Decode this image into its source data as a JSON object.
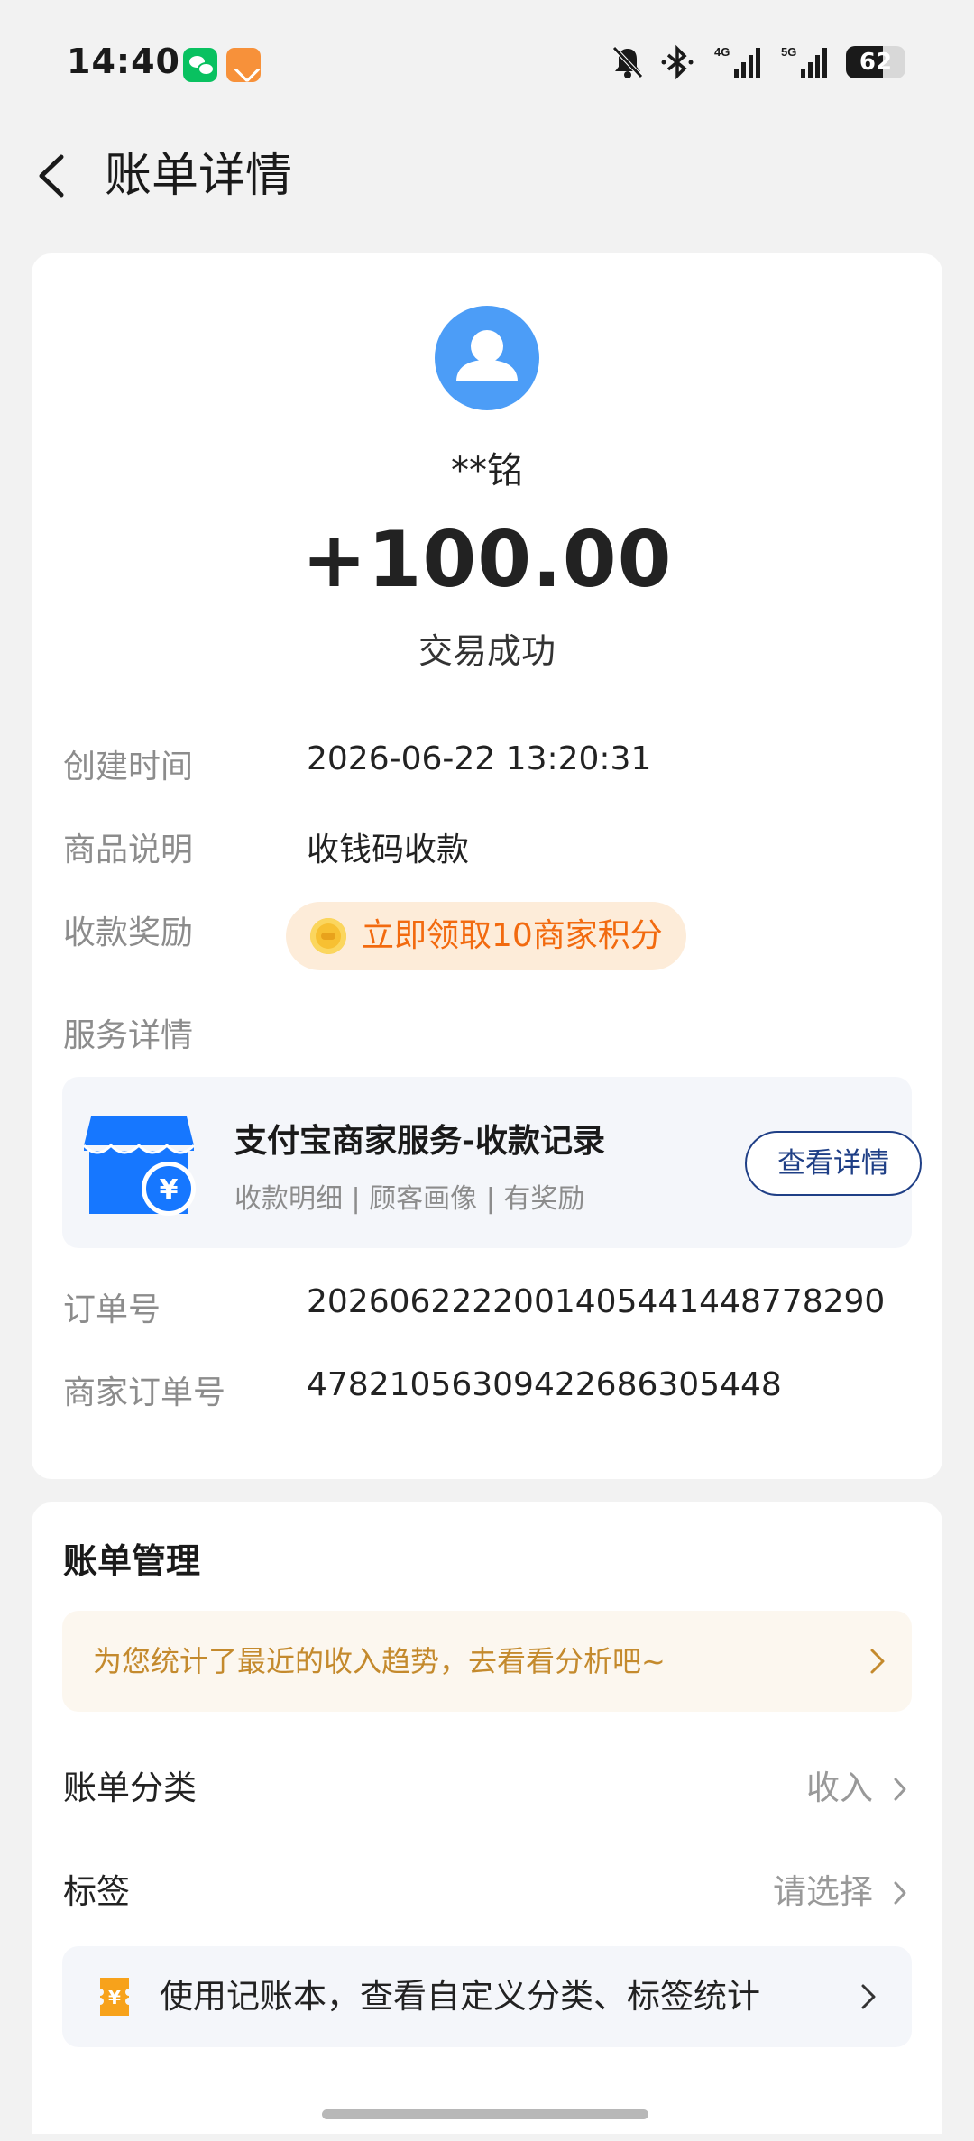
{
  "status_bar": {
    "time": "14:40",
    "battery": "62"
  },
  "nav": {
    "title": "账单详情"
  },
  "transaction": {
    "payer_name": "**铭",
    "amount": "+100.00",
    "status": "交易成功"
  },
  "details": {
    "created_label": "创建时间",
    "created_value": "2026-06-22 13:20:31",
    "product_label": "商品说明",
    "product_value": "收钱码收款",
    "reward_label": "收款奖励",
    "reward_value": "立即领取10商家积分",
    "service_label": "服务详情",
    "order_label": "订单号",
    "order_value": "2026062222001405441448778290",
    "merchant_order_label": "商家订单号",
    "merchant_order_value": "4782105630942268630544​8"
  },
  "service": {
    "title": "支付宝商家服务-收款记录",
    "subtitle": "收款明细 | 顾客画像 | 有奖励",
    "button": "查看详情"
  },
  "manage": {
    "title": "账单管理",
    "tip": "为您统计了最近的收入趋势，去看看分析吧~",
    "category_label": "账单分类",
    "category_value": "收入",
    "tag_label": "标签",
    "tag_value": "请选择",
    "ledger_text": "使用记账本，查看自定义分类、标签统计"
  },
  "colors": {
    "accent_blue": "#1f3f86",
    "avatar_blue": "#4c9df7",
    "reward_orange": "#f26a0f",
    "tip_gold": "#c48a2d"
  },
  "icons": [
    "wechat-icon",
    "orange-app-icon",
    "mute-bell-icon",
    "bluetooth-icon",
    "signal-icon",
    "back-icon",
    "user-avatar-icon",
    "coin-icon",
    "shop-icon",
    "chevron-right-icon",
    "ledger-icon"
  ]
}
